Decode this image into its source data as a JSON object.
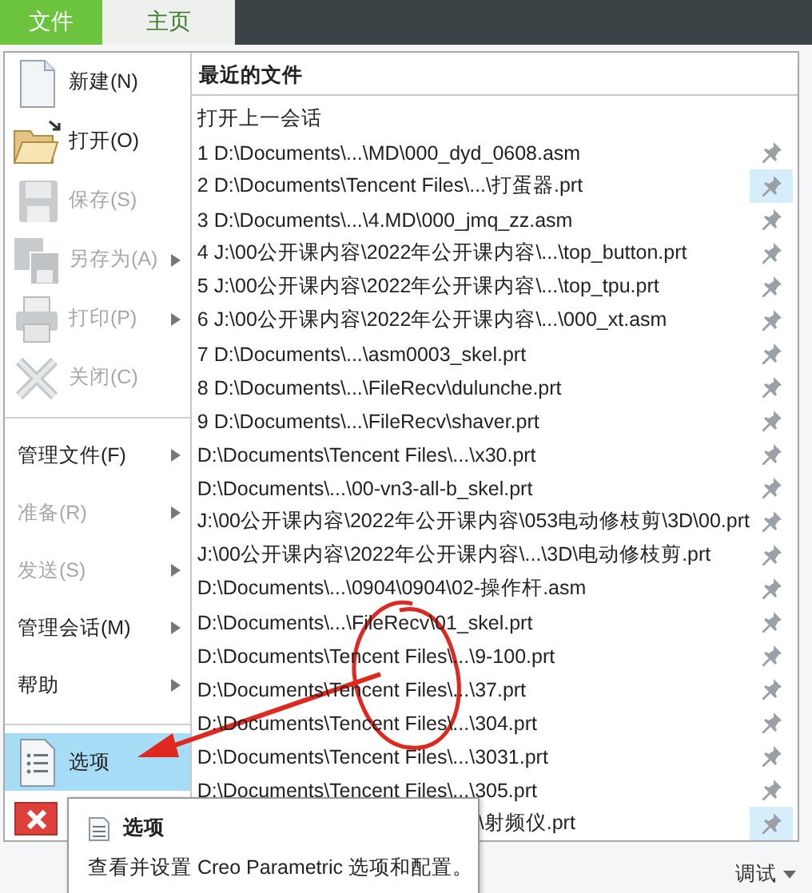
{
  "tabs": [
    {
      "label": "文件",
      "selected": true
    },
    {
      "label": "主页",
      "selected": false
    }
  ],
  "file_commands": [
    {
      "label": "新建(N)",
      "disabled": false,
      "submenu": false
    },
    {
      "label": "打开(O)",
      "disabled": false,
      "submenu": false
    },
    {
      "label": "保存(S)",
      "disabled": true,
      "submenu": false
    },
    {
      "label": "另存为(A)",
      "disabled": true,
      "submenu": true
    },
    {
      "label": "打印(P)",
      "disabled": true,
      "submenu": true
    },
    {
      "label": "关闭(C)",
      "disabled": true,
      "submenu": false
    }
  ],
  "more_commands": [
    {
      "label": "管理文件(F)",
      "disabled": false,
      "submenu": true
    },
    {
      "label": "准备(R)",
      "disabled": true,
      "submenu": true
    },
    {
      "label": "发送(S)",
      "disabled": true,
      "submenu": true
    },
    {
      "label": "管理会话(M)",
      "disabled": false,
      "submenu": true
    },
    {
      "label": "帮助",
      "disabled": false,
      "submenu": true
    }
  ],
  "options_item": {
    "label": "选项",
    "selected": true
  },
  "recent": {
    "title": "最近的文件",
    "open_last": "打开上一会话",
    "files": [
      {
        "text": "1 D:\\Documents\\...\\MD\\000_dyd_0608.asm",
        "kind": "full",
        "highlighted": false
      },
      {
        "text": "2 D:\\Documents\\Tencent Files\\...\\打蛋器.prt",
        "kind": "full",
        "highlighted": true
      },
      {
        "text": "3 D:\\Documents\\...\\4.MD\\000_jmq_zz.asm",
        "kind": "full",
        "highlighted": false
      },
      {
        "text": "4 J:\\00公开课内容\\2022年公开课内容\\...\\top_button.prt",
        "kind": "full",
        "highlighted": false
      },
      {
        "text": "5 J:\\00公开课内容\\2022年公开课内容\\...\\top_tpu.prt",
        "kind": "full",
        "highlighted": false
      },
      {
        "text": "6 J:\\00公开课内容\\2022年公开课内容\\...\\000_xt.asm",
        "kind": "full",
        "highlighted": false
      },
      {
        "text": "7 D:\\Documents\\...\\asm0003_skel.prt",
        "kind": "full",
        "highlighted": false
      },
      {
        "text": "8 D:\\Documents\\...\\FileRecv\\dulunche.prt",
        "kind": "full",
        "highlighted": false
      },
      {
        "text": "9 D:\\Documents\\...\\FileRecv\\shaver.prt",
        "kind": "full",
        "highlighted": false
      },
      {
        "text": "D:\\Documents\\Tencent Files\\...\\x30.prt",
        "kind": "full",
        "highlighted": false
      },
      {
        "text": "D:\\Documents\\...\\00-vn3-all-b_skel.prt",
        "kind": "full",
        "highlighted": false
      },
      {
        "text": "J:\\00公开课内容\\2022年公开课内容\\053电动修枝剪\\3D\\00.prt",
        "kind": "full",
        "highlighted": false
      },
      {
        "text": "J:\\00公开课内容\\2022年公开课内容\\...\\3D\\电动修枝剪.prt",
        "kind": "full",
        "highlighted": false
      },
      {
        "text": "D:\\Documents\\...\\0904\\0904\\02-操作杆.asm",
        "kind": "full",
        "highlighted": false
      },
      {
        "text": "D:\\Documents\\...\\FileRecv\\01_skel.prt",
        "kind": "full",
        "highlighted": false
      },
      {
        "text": "D:\\Documents\\Tencent Files\\...\\9-100.prt",
        "kind": "full",
        "highlighted": false
      },
      {
        "text": "D:\\Documents\\Tencent Files\\...\\37.prt",
        "kind": "full",
        "highlighted": false
      },
      {
        "text": "D:\\Documents\\Tencent Files\\...\\304.prt",
        "kind": "full",
        "highlighted": false
      },
      {
        "text": "D:\\Documents\\Tencent Files\\...\\3031.prt",
        "kind": "full",
        "highlighted": false
      },
      {
        "text": "D:\\Documents\\Tencent Files\\...\\305.prt",
        "kind": "full",
        "highlighted": false
      },
      {
        "text": "\\射频仪.prt",
        "kind": "tail",
        "highlighted": true
      }
    ]
  },
  "tooltip": {
    "title": "选项",
    "description": "查看并设置 Creo Parametric 选项和配置。"
  },
  "bottom_button": {
    "label": "调试"
  }
}
